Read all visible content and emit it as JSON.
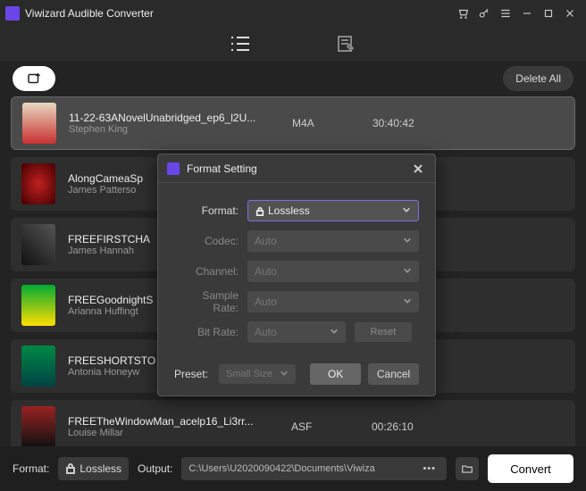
{
  "titlebar": {
    "title": "Viwizard Audible Converter"
  },
  "actions": {
    "delete_all": "Delete All"
  },
  "list": {
    "items": [
      {
        "title": "11-22-63ANovelUnabridged_ep6_l2U...",
        "author": "Stephen King",
        "fmt": "M4A",
        "dur": "30:40:42"
      },
      {
        "title": "AlongCameaSp",
        "author": "James Patterso",
        "fmt": "",
        "dur": ""
      },
      {
        "title": "FREEFIRSTCHA",
        "author": "James Hannah",
        "fmt": "",
        "dur": ""
      },
      {
        "title": "FREEGoodnightS",
        "author": "Arianna Huffingt",
        "fmt": "",
        "dur": ""
      },
      {
        "title": "FREESHORTSTO",
        "author": "Antonia Honeyw",
        "fmt": "",
        "dur": ""
      },
      {
        "title": "FREETheWindowMan_acelp16_Li3rr...",
        "author": "Louise Millar",
        "fmt": "ASF",
        "dur": "00:26:10"
      }
    ]
  },
  "footer": {
    "format_label": "Format:",
    "format_value": "Lossless",
    "output_label": "Output:",
    "output_path": "C:\\Users\\U2020090422\\Documents\\Viwiza",
    "convert": "Convert"
  },
  "modal": {
    "title": "Format Setting",
    "format_label": "Format:",
    "format_value": "Lossless",
    "codec_label": "Codec:",
    "codec_value": "Auto",
    "channel_label": "Channel:",
    "channel_value": "Auto",
    "samplerate_label": "Sample Rate:",
    "samplerate_value": "Auto",
    "bitrate_label": "Bit Rate:",
    "bitrate_value": "Auto",
    "reset": "Reset",
    "preset_label": "Preset:",
    "preset_value": "Small Size",
    "ok": "OK",
    "cancel": "Cancel"
  }
}
